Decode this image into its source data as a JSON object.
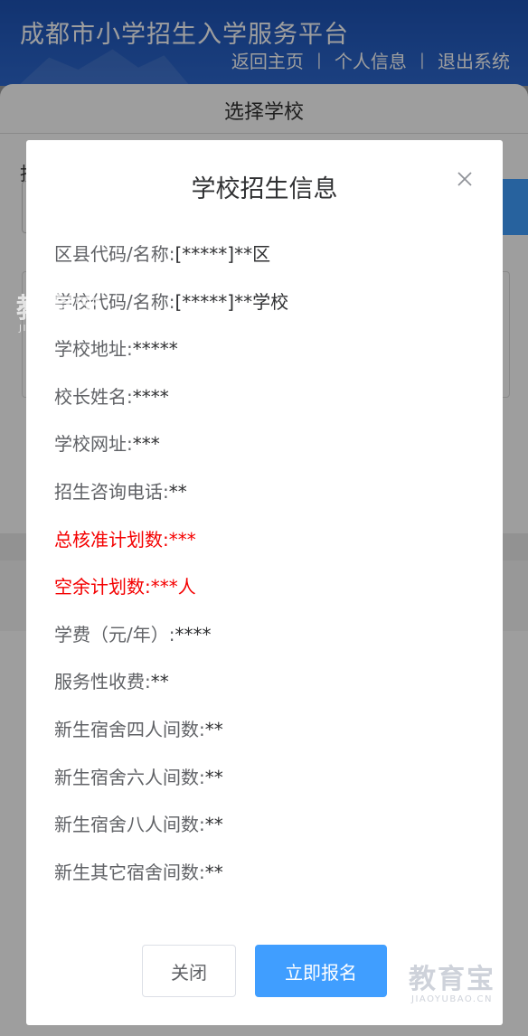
{
  "header": {
    "title": "成都市小学招生入学服务平台",
    "nav": [
      "返回主页",
      "个人信息",
      "退出系统"
    ],
    "separator": "|"
  },
  "page": {
    "title": "选择学校",
    "field_label_char": "抄"
  },
  "dialog": {
    "title": "学校招生信息",
    "rows": [
      {
        "label": "区县代码/名称:",
        "value": "[*****]**区",
        "highlight": false
      },
      {
        "label": "学校代码/名称:",
        "value": "[*****]**学校",
        "highlight": false
      },
      {
        "label": "学校地址:",
        "value": "*****",
        "highlight": false
      },
      {
        "label": "校长姓名:",
        "value": "****",
        "highlight": false
      },
      {
        "label": "学校网址:",
        "value": "***",
        "highlight": false
      },
      {
        "label": "招生咨询电话:",
        "value": "**",
        "highlight": false
      },
      {
        "label": "总核准计划数:",
        "value": "***",
        "highlight": true
      },
      {
        "label": "空余计划数:",
        "value": "***人",
        "highlight": true
      },
      {
        "label": "学费（元/年）:",
        "value": "****",
        "highlight": false
      },
      {
        "label": "服务性收费:",
        "value": "**",
        "highlight": false
      },
      {
        "label": "新生宿舍四人间数:",
        "value": "**",
        "highlight": false
      },
      {
        "label": "新生宿舍六人间数:",
        "value": "**",
        "highlight": false
      },
      {
        "label": "新生宿舍八人间数:",
        "value": "**",
        "highlight": false
      },
      {
        "label": "新生其它宿舍间数:",
        "value": "**",
        "highlight": false
      }
    ],
    "buttons": {
      "close": "关闭",
      "enroll": "立即报名"
    }
  },
  "watermark": {
    "cn": "教育宝",
    "en": "JIAOYUBAO.CN"
  },
  "colors": {
    "primary": "#409eff",
    "highlight": "#f40000",
    "header": "#1d53b6"
  }
}
